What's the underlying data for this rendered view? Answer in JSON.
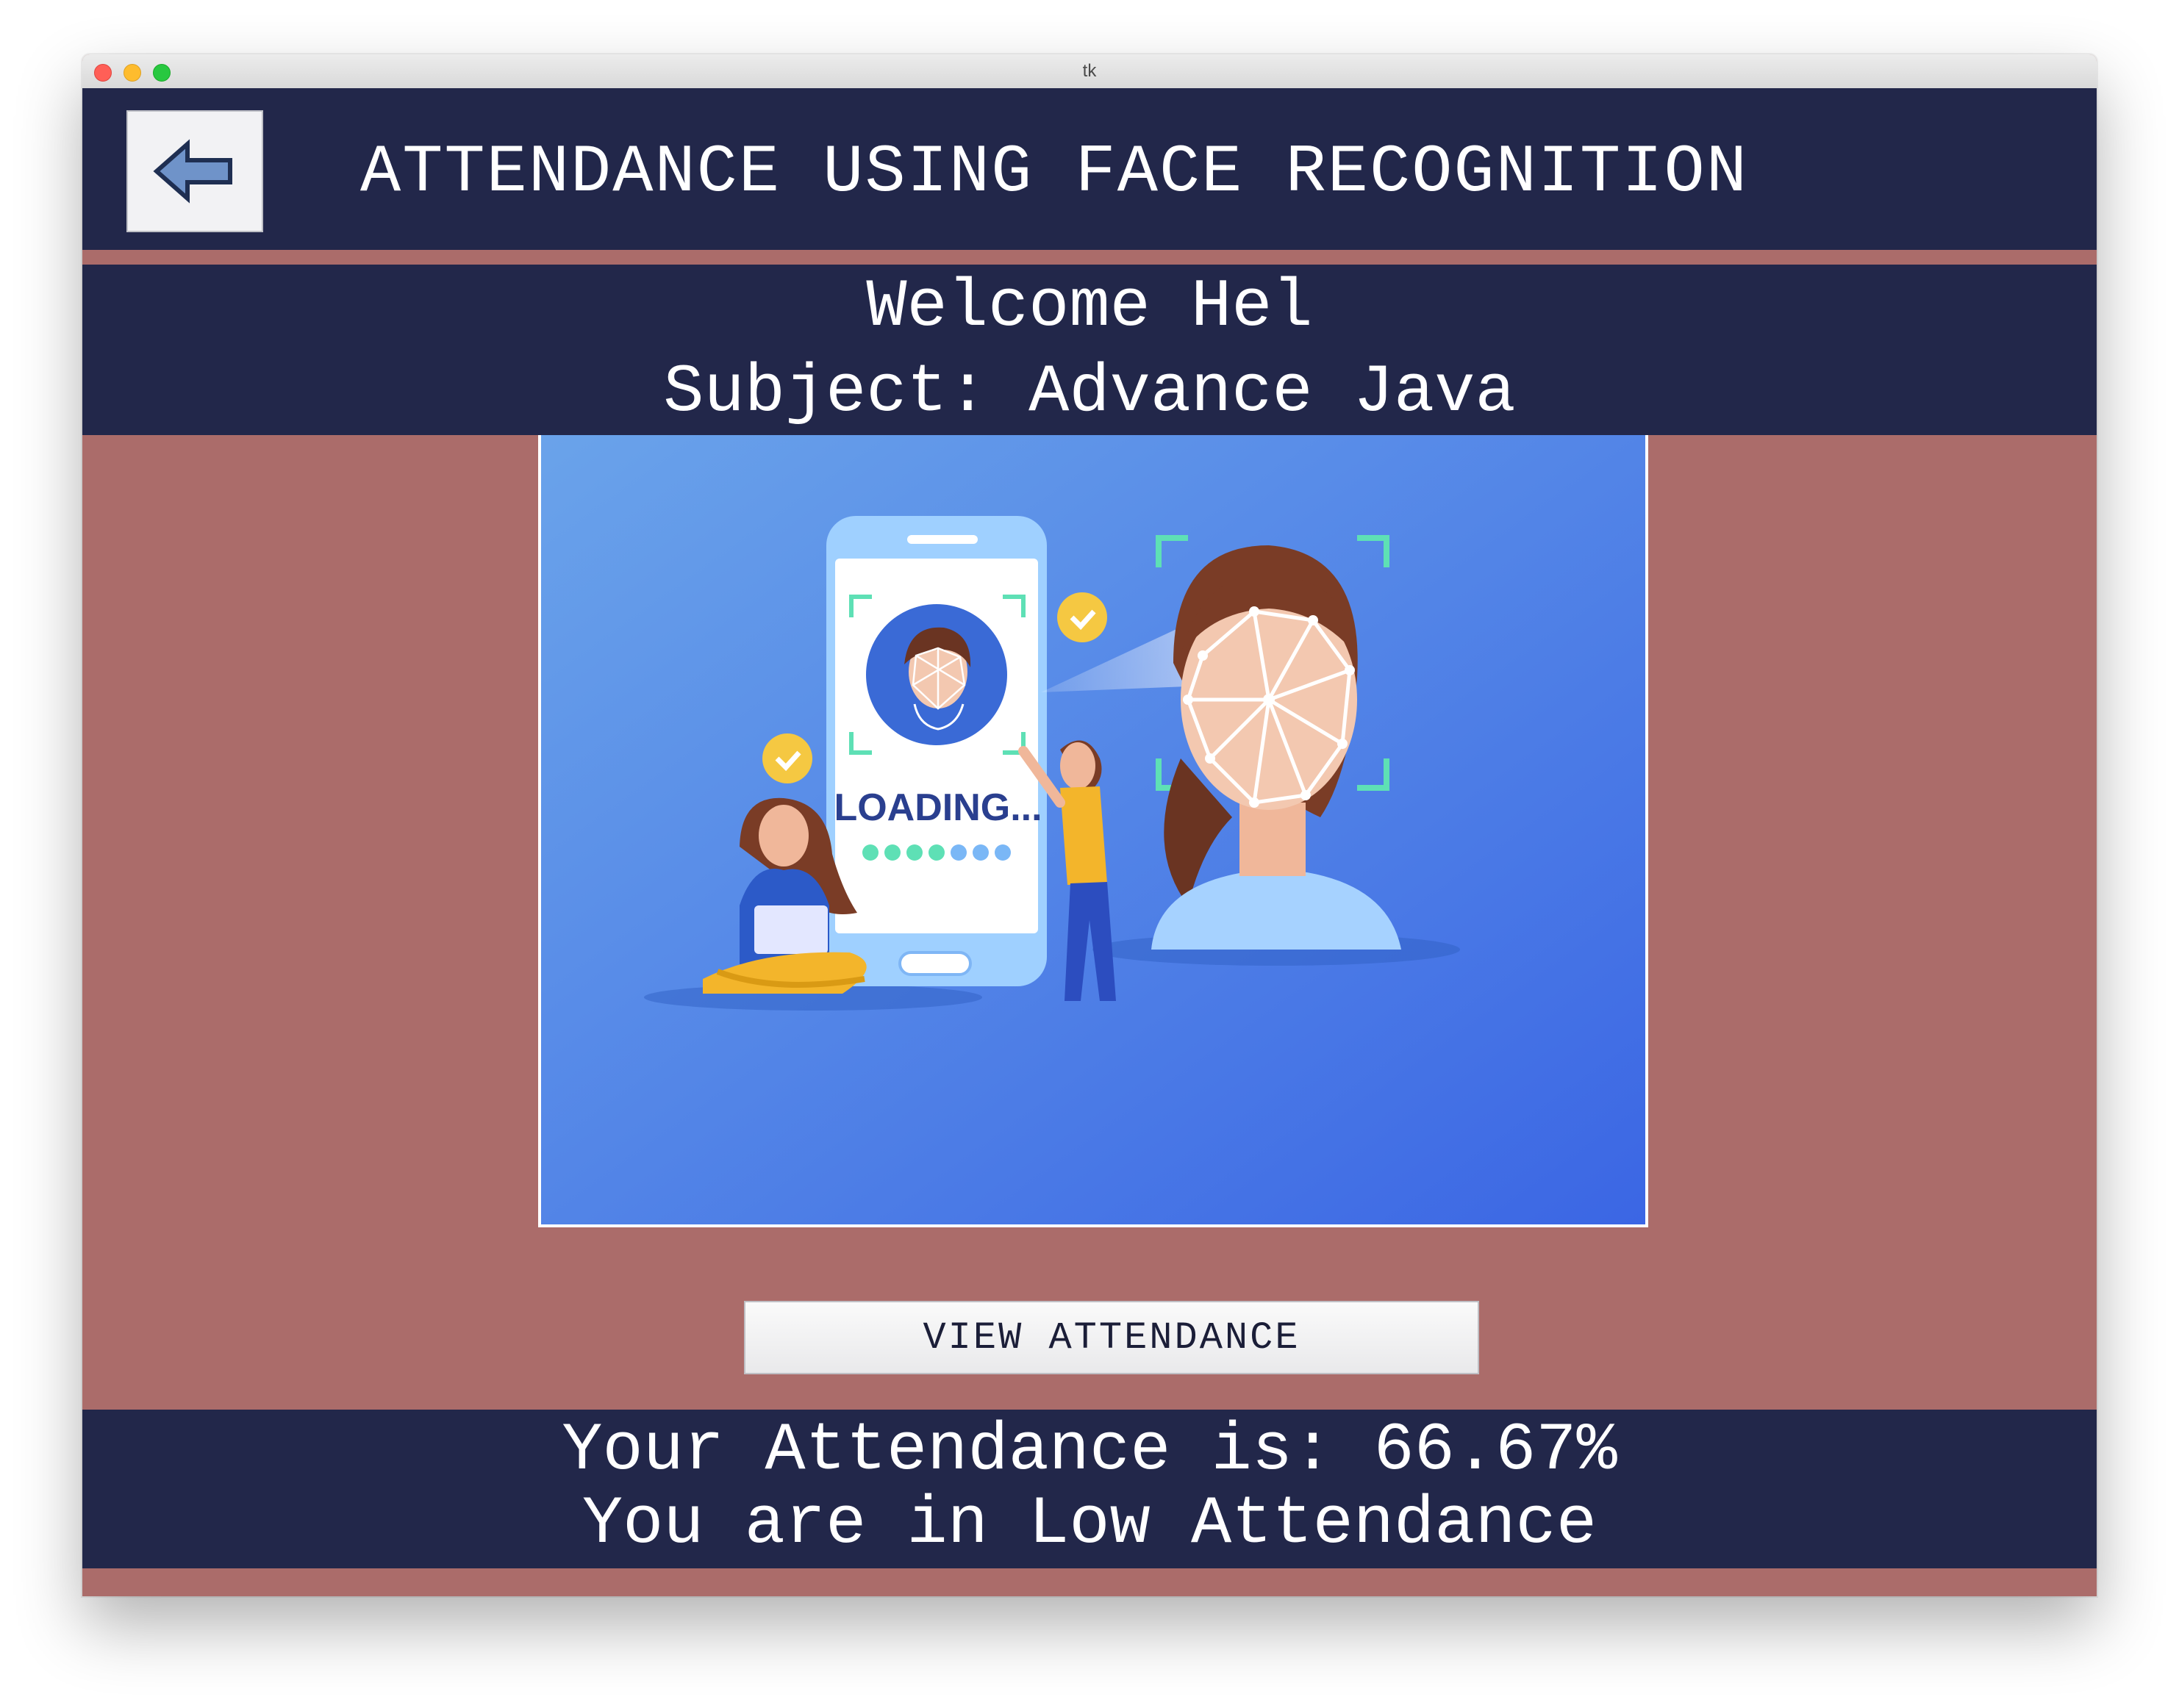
{
  "window": {
    "title": "tk"
  },
  "header": {
    "back_icon": "arrow-left-icon",
    "title": "ATTENDANCE USING FACE RECOGNITION"
  },
  "welcome": {
    "greeting": "Welcome Hel",
    "subject": "Subject: Advance Java"
  },
  "hero": {
    "illustration_text": "LOADING...",
    "icon": "face-recognition-illustration"
  },
  "actions": {
    "view_attendance_label": "VIEW ATTENDANCE"
  },
  "result": {
    "attendance_line": "Your Attendance is: 66.67%",
    "status_line": "You are in Low Attendance"
  },
  "colors": {
    "navy": "#22274a",
    "rose": "#ab6c6a",
    "hero_blue": "#4a80e6"
  }
}
